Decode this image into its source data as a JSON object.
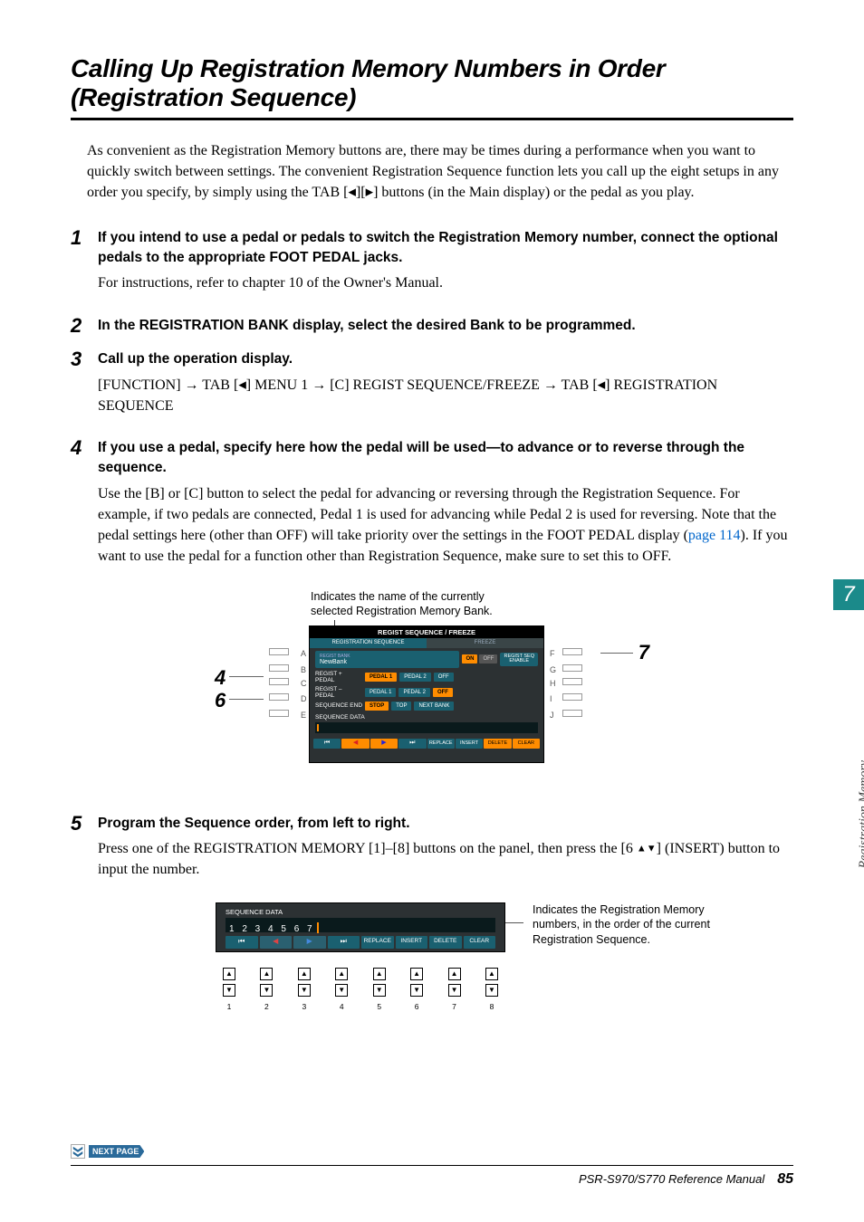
{
  "title": "Calling Up Registration Memory Numbers in Order (Registration Sequence)",
  "intro_parts": {
    "a": "As convenient as the Registration Memory buttons are, there may be times during a performance when you want to quickly switch between settings. The convenient Registration Sequence function lets you call up the eight setups in any order you specify, by simply using the TAB [",
    "lt": "◀",
    "b": "][",
    "gt": "▶",
    "c": "] buttons (in the Main display) or the pedal as you play."
  },
  "steps": {
    "s1_head": "If you intend to use a pedal or pedals to switch the Registration Memory number, connect the optional pedals to the appropriate FOOT PEDAL jacks.",
    "s1_text": "For instructions, refer to chapter 10 of the Owner's Manual.",
    "s2_head": "In the REGISTRATION BANK display, select the desired Bank to be programmed.",
    "s3_head": "Call up the operation display.",
    "s3_text_a": "[FUNCTION] → TAB [",
    "s3_text_b": "] MENU 1 → [C] REGIST SEQUENCE/FREEZE → TAB [",
    "s3_text_c": "] REGISTRATION SEQUENCE",
    "s4_head": "If you use a pedal, specify here how the pedal will be used—to advance or to reverse through the sequence.",
    "s4_text_a": "Use the [B] or [C] button to select the pedal for advancing or reversing through the Registration Sequence. For example, if two pedals are connected, Pedal 1 is used for advancing while Pedal 2 is used for reversing. Note that the pedal settings here (other than OFF) will take priority over the settings in the FOOT PEDAL display (",
    "s4_link": "page 114",
    "s4_text_b": "). If you want to use the pedal for a function other than Registration Sequence, make sure to set this to OFF.",
    "s5_head": "Program the Sequence order, from left to right.",
    "s5_text_a": "Press one of the REGISTRATION MEMORY [1]–[8] buttons on the panel, then press the [6 ",
    "s5_up": "▲",
    "s5_dn": "▼",
    "s5_text_b": "] (INSERT) button to input the number."
  },
  "diag1": {
    "caption": "Indicates the name of the currently selected Registration Memory Bank.",
    "header": "REGIST SEQUENCE / FREEZE",
    "tab1": "REGISTRATION SEQUENCE",
    "tab2": "FREEZE",
    "bank_lbl": "REGIST BANK",
    "bank_name": "NewBank",
    "on": "ON",
    "off": "OFF",
    "enable1": "REGIST SEQ",
    "enable2": "ENABLE",
    "row1_label": "REGIST + PEDAL",
    "row1_opts": [
      "PEDAL 1",
      "PEDAL 2",
      "OFF"
    ],
    "row2_label": "REGIST – PEDAL",
    "row2_opts": [
      "PEDAL 1",
      "PEDAL 2",
      "OFF"
    ],
    "row3_label": "SEQUENCE END",
    "row3_opts": [
      "STOP",
      "TOP",
      "NEXT BANK"
    ],
    "seq_label": "SEQUENCE DATA",
    "bottom": [
      "⏮",
      "◀",
      "▶",
      "⏭",
      "REPLACE",
      "INSERT",
      "DELETE",
      "CLEAR"
    ],
    "left_letters": [
      "A",
      "B",
      "C",
      "D",
      "E"
    ],
    "right_letters": [
      "F",
      "G",
      "H",
      "I",
      "J"
    ],
    "callouts": {
      "n4": "4",
      "n6": "6",
      "n7": "7"
    }
  },
  "diag2": {
    "seq_label": "SEQUENCE DATA",
    "numbers": "1 2 3 4 5 6 7",
    "bottom": [
      "⏮",
      "◀",
      "▶",
      "⏭",
      "REPLACE",
      "INSERT",
      "DELETE",
      "CLEAR"
    ],
    "cols": [
      "1",
      "2",
      "3",
      "4",
      "5",
      "6",
      "7",
      "8"
    ],
    "caption": "Indicates the Registration Memory numbers, in the order of the current Registration Sequence."
  },
  "side_tab": {
    "num": "7",
    "label": "Registration Memory"
  },
  "next_page": "NEXT PAGE",
  "footer": {
    "model": "PSR-S970/S770 Reference Manual",
    "page": "85"
  }
}
